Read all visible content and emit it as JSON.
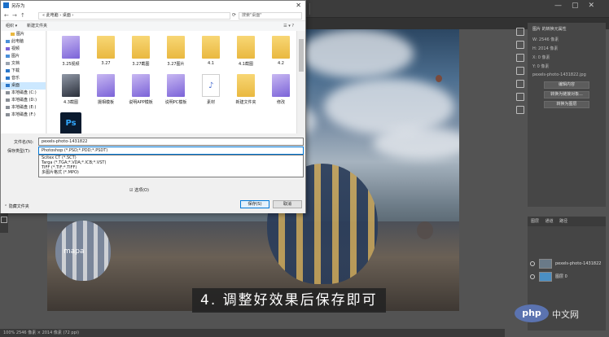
{
  "dialog": {
    "title": "另存为",
    "address_path": "« 此电脑 › 桌面 ›",
    "search_placeholder": "搜索\"桌面\"",
    "toolbar": {
      "organize": "组织 ▾",
      "new_folder": "新建文件夹"
    },
    "nav_items": [
      {
        "label": "图片",
        "icon_color": "#e9b840"
      },
      {
        "label": "此电脑",
        "icon_color": "#4a90d9"
      },
      {
        "label": "视频",
        "icon_color": "#7b63d8"
      },
      {
        "label": "图片",
        "icon_color": "#4a90d9"
      },
      {
        "label": "文档",
        "icon_color": "#9aa4b0"
      },
      {
        "label": "下载",
        "icon_color": "#2a76c9"
      },
      {
        "label": "音乐",
        "icon_color": "#2a76c9"
      },
      {
        "label": "桌面",
        "icon_color": "#2a76c9",
        "selected": true
      },
      {
        "label": "本地磁盘 (C:)",
        "icon_color": "#8a8f96"
      },
      {
        "label": "本地磁盘 (D:)",
        "icon_color": "#8a8f96"
      },
      {
        "label": "本地磁盘 (E:)",
        "icon_color": "#8a8f96"
      },
      {
        "label": "本地磁盘 (F:)",
        "icon_color": "#8a8f96"
      }
    ],
    "files": [
      {
        "label": "3.25视频",
        "icon": "purple-folder-icon"
      },
      {
        "label": "3.27",
        "icon": "folder-icon"
      },
      {
        "label": "3.27截图",
        "icon": "folder-icon"
      },
      {
        "label": "3.27图片",
        "icon": "folder-icon"
      },
      {
        "label": "4.1",
        "icon": "folder-icon"
      },
      {
        "label": "4.1截图",
        "icon": "folder-icon"
      },
      {
        "label": "4.2",
        "icon": "folder-icon"
      },
      {
        "label": "4.3截图",
        "icon": "dark-folder-icon"
      },
      {
        "label": "摄相模板",
        "icon": "purple-folder-icon"
      },
      {
        "label": "说明APP模板",
        "icon": "purple-folder-icon"
      },
      {
        "label": "说明PC模板",
        "icon": "purple-folder-icon"
      },
      {
        "label": "素材",
        "icon": "music-doc-icon"
      },
      {
        "label": "新建文件夹",
        "icon": "folder-icon"
      },
      {
        "label": "修改",
        "icon": "purple-folder-icon"
      },
      {
        "label": "Ps",
        "icon": "photoshop-icon"
      }
    ],
    "filename_label": "文件名(N):",
    "filename_value": "pexels-photo-1431822",
    "filetype_label": "保存类型(T):",
    "filetype_value": "Photoshop (*.PSD;*.PDD;*.PSDT)",
    "filetype_options": [
      "Scitex CT (*.SCT)",
      "Targa (*.TGA;*.VDA;*.ICB;*.VST)",
      "TIFF (*.TIF;*.TIFF)",
      "多图片格式 (*.MPO)"
    ],
    "save_options_label": "☑ 选项(O)",
    "hide_folders_label": "⌃ 隐藏文件夹",
    "save_button": "保存(S)",
    "cancel_button": "取消"
  },
  "photoshop": {
    "balloon_text": "mapa",
    "caption": "4. 调整好效果后保存即可",
    "properties": {
      "title": "图片 的转换元属性",
      "w_label": "W: 2546 像素",
      "h_label": "H: 2014 像素",
      "x_label": "X: 0 像素",
      "y_label": "Y: 0 像素",
      "file_label": "pexels-photo-1431822.jpg",
      "buttons": [
        "编辑内容",
        "转换为链接对象...",
        "转换为图层"
      ]
    },
    "layers": {
      "tabs": "图层 通道 路径",
      "rows": [
        "pexels-photo-1431822",
        "图层 0"
      ]
    },
    "status": "100% 2546 像素 × 2014 像素 (72 ppi)"
  },
  "watermark": {
    "logo": "php",
    "text": "中文网"
  }
}
